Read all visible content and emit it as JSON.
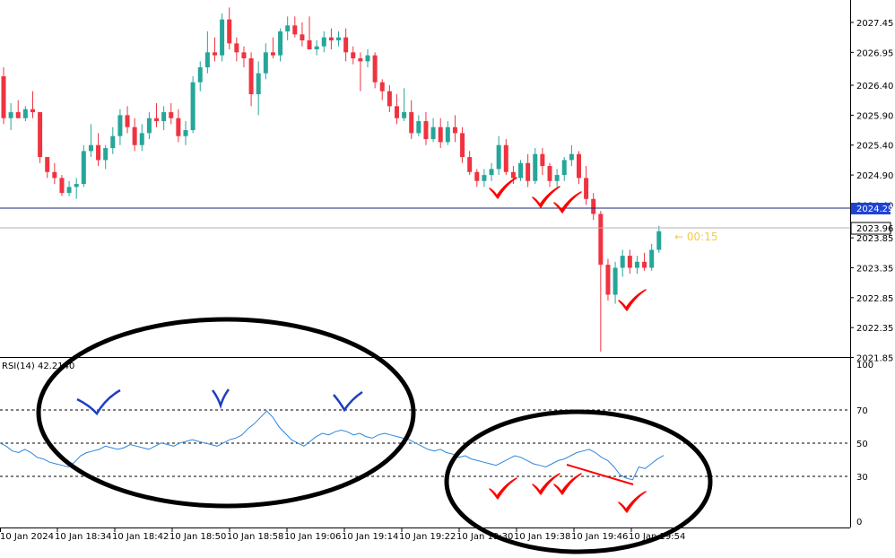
{
  "price_axis": {
    "labels": [
      "2027.45",
      "2026.95",
      "2026.40",
      "2025.90",
      "2025.40",
      "2024.90",
      "2024.40",
      "2023.85",
      "2023.35",
      "2022.85",
      "2022.35",
      "2021.85"
    ]
  },
  "markers": {
    "hline_price": "2024.29",
    "current_price": "2023.96",
    "countdown": "← 00:15"
  },
  "rsi": {
    "label": "RSI(14) 42.2140",
    "axis_labels": [
      "100",
      "70",
      "50",
      "30",
      "0"
    ]
  },
  "time_axis": {
    "labels": [
      "10 Jan 2024",
      "10 Jan 18:34",
      "10 Jan 18:42",
      "10 Jan 18:50",
      "10 Jan 18:58",
      "10 Jan 19:06",
      "10 Jan 19:14",
      "10 Jan 19:22",
      "10 Jan 19:30",
      "10 Jan 19:38",
      "10 Jan 19:46",
      "10 Jan 19:54"
    ]
  },
  "colors": {
    "bull": "#26a69a",
    "bear": "#ef3340",
    "price_line": "#1a237e",
    "label_bg_blue": "#1e43d8",
    "rsi_line": "#2e86de",
    "annotation_black": "#000000",
    "annotation_red": "#ff0000",
    "annotation_blue": "#1f3fbf",
    "countdown": "#f2c94c"
  },
  "chart_data": [
    {
      "type": "candlestick",
      "xlabel": "",
      "ylabel": "",
      "ylim": [
        2021.7,
        2028.15
      ],
      "candles": [
        {
          "o": 2026.55,
          "h": 2026.7,
          "l": 2025.75,
          "c": 2025.85
        },
        {
          "o": 2025.85,
          "h": 2026.1,
          "l": 2025.65,
          "c": 2025.95
        },
        {
          "o": 2025.95,
          "h": 2026.15,
          "l": 2025.85,
          "c": 2025.85
        },
        {
          "o": 2025.85,
          "h": 2026.05,
          "l": 2025.8,
          "c": 2026.0
        },
        {
          "o": 2026.0,
          "h": 2026.3,
          "l": 2025.85,
          "c": 2025.95
        },
        {
          "o": 2025.95,
          "h": 2025.95,
          "l": 2025.1,
          "c": 2025.2
        },
        {
          "o": 2025.2,
          "h": 2025.2,
          "l": 2024.85,
          "c": 2024.95
        },
        {
          "o": 2024.95,
          "h": 2025.1,
          "l": 2024.75,
          "c": 2024.85
        },
        {
          "o": 2024.85,
          "h": 2024.9,
          "l": 2024.55,
          "c": 2024.6
        },
        {
          "o": 2024.6,
          "h": 2024.8,
          "l": 2024.55,
          "c": 2024.7
        },
        {
          "o": 2024.7,
          "h": 2024.85,
          "l": 2024.5,
          "c": 2024.75
        },
        {
          "o": 2024.75,
          "h": 2025.4,
          "l": 2024.7,
          "c": 2025.3
        },
        {
          "o": 2025.3,
          "h": 2025.75,
          "l": 2025.2,
          "c": 2025.4
        },
        {
          "o": 2025.4,
          "h": 2025.6,
          "l": 2025.05,
          "c": 2025.15
        },
        {
          "o": 2025.15,
          "h": 2025.4,
          "l": 2025.0,
          "c": 2025.35
        },
        {
          "o": 2025.35,
          "h": 2025.7,
          "l": 2025.25,
          "c": 2025.55
        },
        {
          "o": 2025.55,
          "h": 2026.0,
          "l": 2025.4,
          "c": 2025.9
        },
        {
          "o": 2025.9,
          "h": 2026.05,
          "l": 2025.6,
          "c": 2025.7
        },
        {
          "o": 2025.7,
          "h": 2025.85,
          "l": 2025.3,
          "c": 2025.4
        },
        {
          "o": 2025.4,
          "h": 2025.75,
          "l": 2025.3,
          "c": 2025.6
        },
        {
          "o": 2025.6,
          "h": 2025.95,
          "l": 2025.5,
          "c": 2025.85
        },
        {
          "o": 2025.85,
          "h": 2026.1,
          "l": 2025.7,
          "c": 2025.8
        },
        {
          "o": 2025.8,
          "h": 2026.05,
          "l": 2025.65,
          "c": 2025.95
        },
        {
          "o": 2025.95,
          "h": 2026.1,
          "l": 2025.75,
          "c": 2025.85
        },
        {
          "o": 2025.85,
          "h": 2026.0,
          "l": 2025.45,
          "c": 2025.55
        },
        {
          "o": 2025.55,
          "h": 2025.8,
          "l": 2025.4,
          "c": 2025.65
        },
        {
          "o": 2025.65,
          "h": 2026.55,
          "l": 2025.6,
          "c": 2026.45
        },
        {
          "o": 2026.45,
          "h": 2026.8,
          "l": 2026.3,
          "c": 2026.7
        },
        {
          "o": 2026.7,
          "h": 2027.3,
          "l": 2026.6,
          "c": 2026.95
        },
        {
          "o": 2026.95,
          "h": 2027.2,
          "l": 2026.8,
          "c": 2026.9
        },
        {
          "o": 2026.9,
          "h": 2027.6,
          "l": 2026.8,
          "c": 2027.5
        },
        {
          "o": 2027.5,
          "h": 2027.7,
          "l": 2027.0,
          "c": 2027.1
        },
        {
          "o": 2027.1,
          "h": 2027.2,
          "l": 2026.8,
          "c": 2026.95
        },
        {
          "o": 2026.95,
          "h": 2027.05,
          "l": 2026.7,
          "c": 2026.85
        },
        {
          "o": 2026.85,
          "h": 2026.95,
          "l": 2026.05,
          "c": 2026.25
        },
        {
          "o": 2026.25,
          "h": 2026.8,
          "l": 2025.9,
          "c": 2026.6
        },
        {
          "o": 2026.6,
          "h": 2027.1,
          "l": 2026.5,
          "c": 2026.95
        },
        {
          "o": 2026.95,
          "h": 2027.2,
          "l": 2026.85,
          "c": 2026.9
        },
        {
          "o": 2026.9,
          "h": 2027.35,
          "l": 2026.8,
          "c": 2027.3
        },
        {
          "o": 2027.3,
          "h": 2027.55,
          "l": 2027.15,
          "c": 2027.4
        },
        {
          "o": 2027.4,
          "h": 2027.55,
          "l": 2027.2,
          "c": 2027.25
        },
        {
          "o": 2027.25,
          "h": 2027.45,
          "l": 2027.05,
          "c": 2027.15
        },
        {
          "o": 2027.15,
          "h": 2027.55,
          "l": 2027.0,
          "c": 2027.0
        },
        {
          "o": 2027.0,
          "h": 2027.15,
          "l": 2026.9,
          "c": 2027.05
        },
        {
          "o": 2027.05,
          "h": 2027.3,
          "l": 2026.95,
          "c": 2027.2
        },
        {
          "o": 2027.2,
          "h": 2027.35,
          "l": 2027.0,
          "c": 2027.15
        },
        {
          "o": 2027.15,
          "h": 2027.3,
          "l": 2027.05,
          "c": 2027.2
        },
        {
          "o": 2027.2,
          "h": 2027.35,
          "l": 2026.8,
          "c": 2026.95
        },
        {
          "o": 2026.95,
          "h": 2027.05,
          "l": 2026.75,
          "c": 2026.85
        },
        {
          "o": 2026.85,
          "h": 2026.95,
          "l": 2026.3,
          "c": 2026.8
        },
        {
          "o": 2026.8,
          "h": 2027.0,
          "l": 2026.7,
          "c": 2026.9
        },
        {
          "o": 2026.9,
          "h": 2026.95,
          "l": 2026.35,
          "c": 2026.45
        },
        {
          "o": 2026.45,
          "h": 2026.5,
          "l": 2026.15,
          "c": 2026.3
        },
        {
          "o": 2026.3,
          "h": 2026.4,
          "l": 2025.95,
          "c": 2026.05
        },
        {
          "o": 2026.05,
          "h": 2026.25,
          "l": 2025.75,
          "c": 2025.85
        },
        {
          "o": 2025.85,
          "h": 2026.35,
          "l": 2025.8,
          "c": 2025.95
        },
        {
          "o": 2025.95,
          "h": 2026.15,
          "l": 2025.5,
          "c": 2025.6
        },
        {
          "o": 2025.6,
          "h": 2025.9,
          "l": 2025.55,
          "c": 2025.8
        },
        {
          "o": 2025.8,
          "h": 2025.95,
          "l": 2025.4,
          "c": 2025.5
        },
        {
          "o": 2025.5,
          "h": 2025.85,
          "l": 2025.45,
          "c": 2025.7
        },
        {
          "o": 2025.7,
          "h": 2025.85,
          "l": 2025.35,
          "c": 2025.45
        },
        {
          "o": 2025.45,
          "h": 2025.8,
          "l": 2025.4,
          "c": 2025.7
        },
        {
          "o": 2025.7,
          "h": 2025.9,
          "l": 2025.45,
          "c": 2025.6
        },
        {
          "o": 2025.6,
          "h": 2025.7,
          "l": 2025.1,
          "c": 2025.2
        },
        {
          "o": 2025.2,
          "h": 2025.3,
          "l": 2024.9,
          "c": 2024.95
        },
        {
          "o": 2024.95,
          "h": 2025.0,
          "l": 2024.7,
          "c": 2024.8
        },
        {
          "o": 2024.8,
          "h": 2025.0,
          "l": 2024.7,
          "c": 2024.9
        },
        {
          "o": 2024.9,
          "h": 2025.1,
          "l": 2024.8,
          "c": 2025.0
        },
        {
          "o": 2025.0,
          "h": 2025.55,
          "l": 2024.9,
          "c": 2025.4
        },
        {
          "o": 2025.4,
          "h": 2025.5,
          "l": 2024.9,
          "c": 2024.95
        },
        {
          "o": 2024.95,
          "h": 2025.05,
          "l": 2024.75,
          "c": 2024.85
        },
        {
          "o": 2024.85,
          "h": 2025.15,
          "l": 2024.8,
          "c": 2025.1
        },
        {
          "o": 2025.1,
          "h": 2025.25,
          "l": 2024.7,
          "c": 2024.8
        },
        {
          "o": 2024.8,
          "h": 2025.35,
          "l": 2024.75,
          "c": 2025.25
        },
        {
          "o": 2025.25,
          "h": 2025.35,
          "l": 2024.9,
          "c": 2025.05
        },
        {
          "o": 2025.05,
          "h": 2025.1,
          "l": 2024.7,
          "c": 2024.8
        },
        {
          "o": 2024.8,
          "h": 2025.0,
          "l": 2024.7,
          "c": 2024.9
        },
        {
          "o": 2024.9,
          "h": 2025.2,
          "l": 2024.8,
          "c": 2025.15
        },
        {
          "o": 2025.15,
          "h": 2025.4,
          "l": 2025.05,
          "c": 2025.25
        },
        {
          "o": 2025.25,
          "h": 2025.3,
          "l": 2024.75,
          "c": 2024.85
        },
        {
          "o": 2024.85,
          "h": 2025.05,
          "l": 2024.4,
          "c": 2024.5
        },
        {
          "o": 2024.5,
          "h": 2024.6,
          "l": 2024.15,
          "c": 2024.25
        },
        {
          "o": 2024.25,
          "h": 2024.3,
          "l": 2021.95,
          "c": 2023.4
        },
        {
          "o": 2023.4,
          "h": 2023.5,
          "l": 2022.8,
          "c": 2022.9
        },
        {
          "o": 2022.9,
          "h": 2023.45,
          "l": 2022.75,
          "c": 2023.35
        },
        {
          "o": 2023.35,
          "h": 2023.65,
          "l": 2023.2,
          "c": 2023.55
        },
        {
          "o": 2023.55,
          "h": 2023.65,
          "l": 2023.25,
          "c": 2023.35
        },
        {
          "o": 2023.35,
          "h": 2023.55,
          "l": 2023.25,
          "c": 2023.45
        },
        {
          "o": 2023.45,
          "h": 2023.6,
          "l": 2023.3,
          "c": 2023.35
        },
        {
          "o": 2023.35,
          "h": 2023.75,
          "l": 2023.3,
          "c": 2023.65
        },
        {
          "o": 2023.65,
          "h": 2024.05,
          "l": 2023.6,
          "c": 2023.96
        }
      ],
      "horizontal_lines": [
        2024.29,
        2023.96
      ]
    },
    {
      "type": "line",
      "ylim": [
        0,
        100
      ],
      "levels": [
        30,
        50,
        70
      ],
      "series": [
        {
          "name": "RSI(14)",
          "values": [
            50,
            48,
            45,
            44,
            46,
            44,
            41,
            40,
            38,
            37,
            36,
            35,
            38,
            42,
            44,
            45,
            46,
            48,
            47,
            46,
            47,
            49,
            48,
            47,
            46,
            48,
            50,
            49,
            48,
            50,
            51,
            52,
            51,
            50,
            49,
            48,
            50,
            52,
            53,
            55,
            59,
            62,
            66,
            70,
            66,
            60,
            56,
            52,
            50,
            48,
            51,
            54,
            56,
            55,
            57,
            58,
            57,
            55,
            56,
            54,
            53,
            55,
            56,
            55,
            54,
            53,
            52,
            50,
            48,
            46,
            45,
            46,
            44,
            43,
            41,
            42,
            40,
            39,
            38,
            37,
            36,
            38,
            40,
            42,
            41,
            39,
            37,
            36,
            35,
            37,
            39,
            40,
            42,
            44,
            45,
            46,
            44,
            41,
            39,
            35,
            30,
            28,
            27,
            35,
            34,
            37,
            40,
            42.2
          ]
        }
      ]
    }
  ]
}
